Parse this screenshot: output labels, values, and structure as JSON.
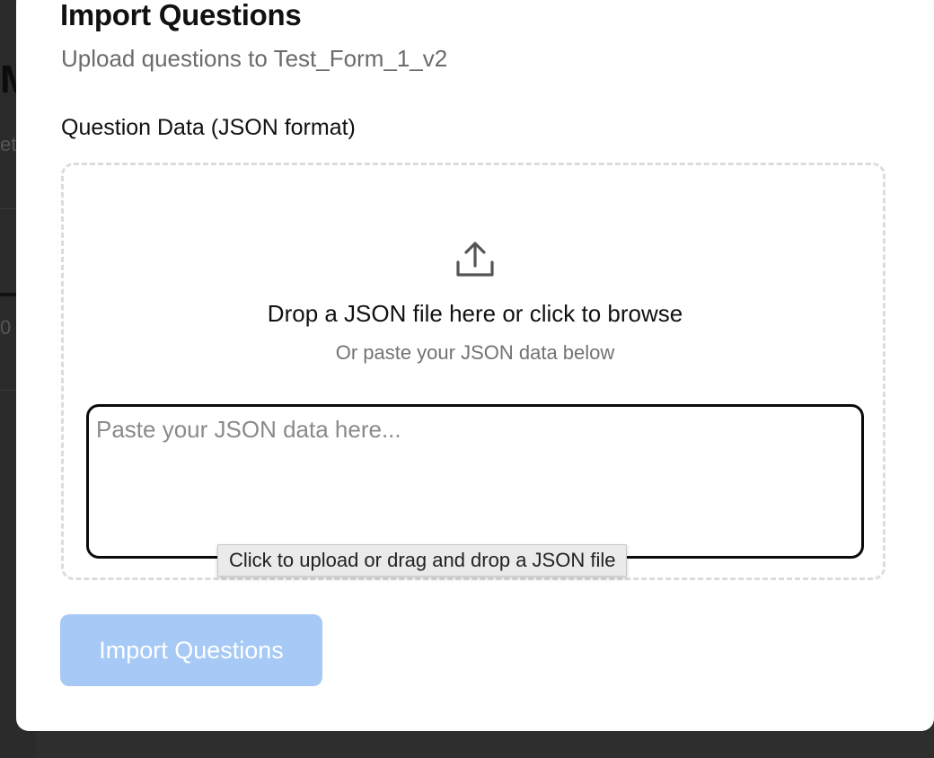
{
  "background": {
    "heading_glyph": "M",
    "sub_glyph": "et",
    "number_glyph": "0"
  },
  "modal": {
    "title": "Import Questions",
    "subtitle": "Upload questions to Test_Form_1_v2",
    "close_icon": "close-icon",
    "field_label": "Question Data (JSON format)",
    "dropzone": {
      "icon": "upload-icon",
      "primary_text": "Drop a JSON file here or click to browse",
      "secondary_text": "Or paste your JSON data below"
    },
    "textarea": {
      "value": "",
      "placeholder": "Paste your JSON data here..."
    },
    "tooltip": "Click to upload or drag and drop a JSON file",
    "import_button_label": "Import Questions"
  },
  "colors": {
    "import_button_disabled": "#a6c9f5",
    "textarea_border_focus": "#0a0a0a",
    "dropzone_border": "#dcdcdc"
  }
}
